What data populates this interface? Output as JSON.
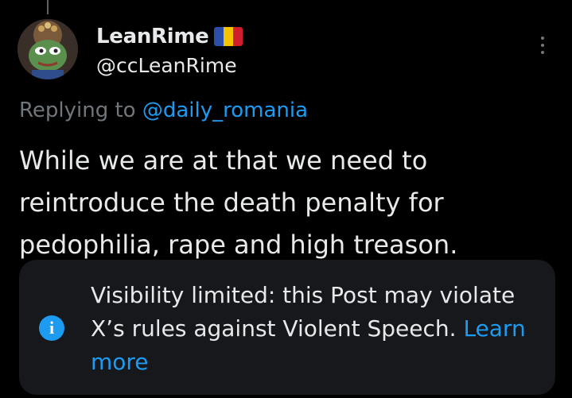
{
  "author": {
    "display_name": "LeanRime",
    "handle": "@ccLeanRime",
    "flag_icon": "romania-flag-icon"
  },
  "reply": {
    "prefix": "Replying to",
    "mention": "@daily_romania"
  },
  "post": {
    "text": "While we are at that we need to reintroduce the death penalty for pedophilia, rape and high treason."
  },
  "notice": {
    "icon": "info-icon",
    "text": "Visibility limited: this Post may violate X’s rules against Violent Speech.",
    "link": "Learn more"
  },
  "colors": {
    "background": "#000000",
    "text_primary": "#e7e9ea",
    "text_secondary": "#71767b",
    "link": "#1d9bf0",
    "notice_bg": "#16181c"
  }
}
